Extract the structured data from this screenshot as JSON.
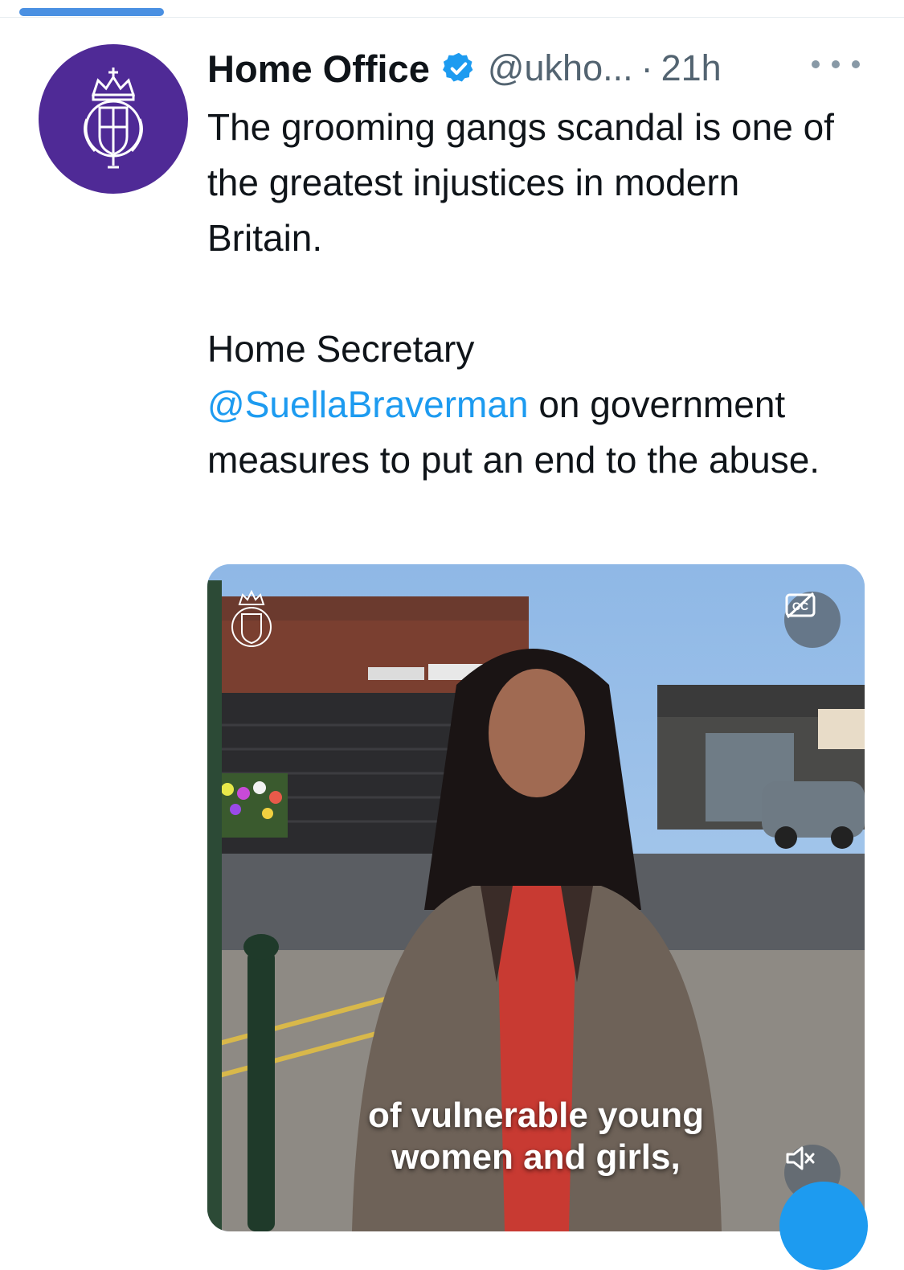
{
  "tweet": {
    "display_name": "Home Office",
    "verified": true,
    "handle": "@ukho...",
    "separator": "·",
    "timestamp": "21h",
    "text_para1": "The grooming gangs scandal is one of the greatest injustices in modern Britain.",
    "text_para2_prefix": "Home Secretary",
    "mention": "@SuellaBraverman",
    "text_para2_suffix": " on government measures to put an end to the abuse."
  },
  "media": {
    "type": "video",
    "caption_line1": "of vulnerable young",
    "caption_line2": "women and girls,",
    "muted": true,
    "captions_available": true
  },
  "icons": {
    "avatar": "royal-crest-icon",
    "verified": "verified-badge-icon",
    "more": "more-options-icon",
    "cc": "closed-captions-icon",
    "mute": "speaker-muted-icon"
  },
  "colors": {
    "accent": "#1d9bf0",
    "avatar_bg": "#4f2a96",
    "text": "#0f1419",
    "secondary_text": "#536471"
  }
}
